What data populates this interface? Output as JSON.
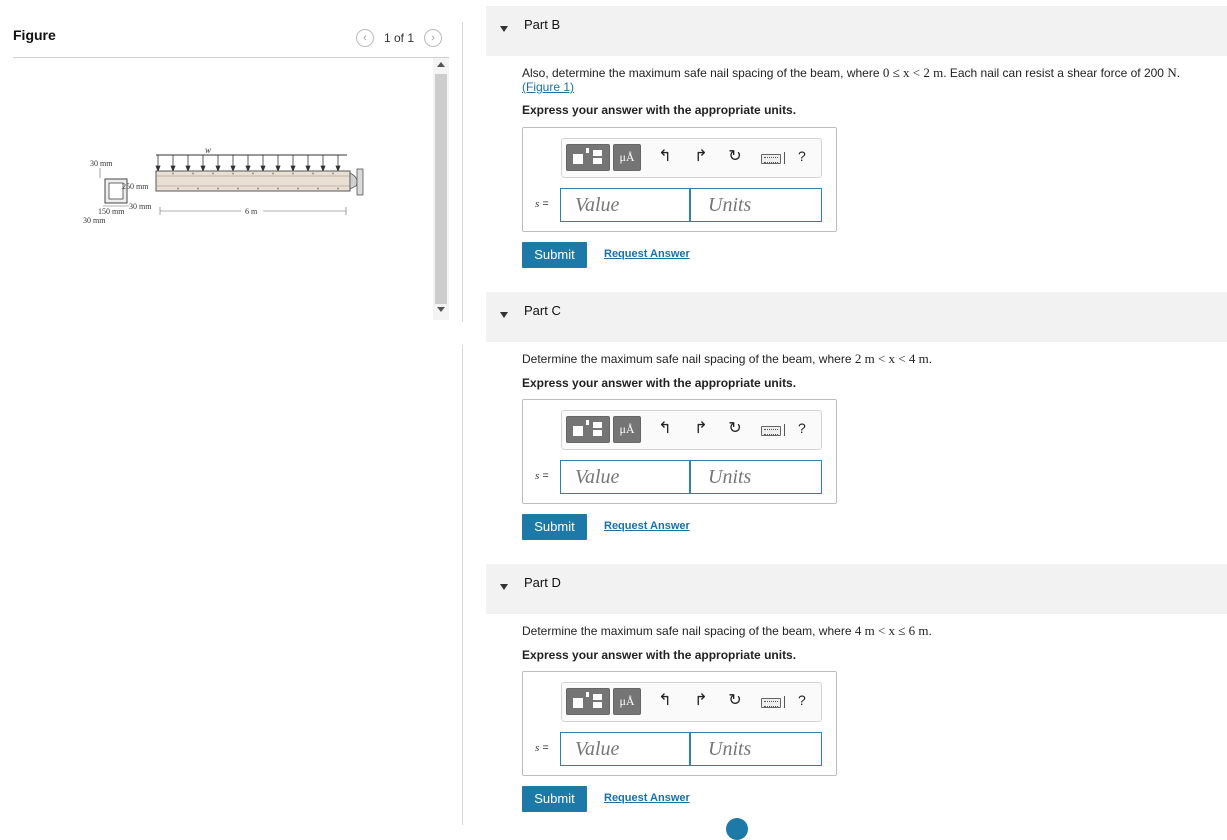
{
  "figure_panel": {
    "title": "Figure",
    "pager_text": "1 of 1",
    "diagram_labels": {
      "load": "w",
      "dim_30_top": "30 mm",
      "dim_250": "250 mm",
      "dim_30_mid": "30 mm",
      "dim_150": "150 mm",
      "dim_30_bot": "30 mm",
      "span": "6 m"
    }
  },
  "parts": [
    {
      "title": "Part B",
      "prompt_pre": "Also, determine the maximum safe nail spacing of the beam, where",
      "prompt_math": "0 ≤ x < 2 m",
      "prompt_post": ". Each nail can resist a shear force of 200",
      "prompt_math2": "N",
      "prompt_end": ".",
      "figure_link": "(Figure 1)",
      "express": "Express your answer with the appropriate units.",
      "var_label": "s",
      "value_placeholder": "Value",
      "units_placeholder": "Units",
      "submit_label": "Submit",
      "request_label": "Request Answer"
    },
    {
      "title": "Part C",
      "prompt_pre": "Determine the maximum safe nail spacing of the beam, where",
      "prompt_math": "2 m < x < 4 m",
      "prompt_post": ".",
      "express": "Express your answer with the appropriate units.",
      "var_label": "s",
      "value_placeholder": "Value",
      "units_placeholder": "Units",
      "submit_label": "Submit",
      "request_label": "Request Answer"
    },
    {
      "title": "Part D",
      "prompt_pre": "Determine the maximum safe nail spacing of the beam, where",
      "prompt_math": "4 m < x ≤ 6 m",
      "prompt_post": ".",
      "express": "Express your answer with the appropriate units.",
      "var_label": "s",
      "value_placeholder": "Value",
      "units_placeholder": "Units",
      "submit_label": "Submit",
      "request_label": "Request Answer"
    }
  ],
  "toolbar": {
    "units_symbol": "μÅ",
    "help_symbol": "?",
    "undo_icon": "undo-icon",
    "redo_icon": "redo-icon",
    "reset_icon": "reset-icon",
    "keyboard_icon": "keyboard-icon"
  },
  "colors": {
    "accent": "#1d7aa8",
    "link": "#1a6fa8",
    "header_bg": "#f2f2f2"
  }
}
